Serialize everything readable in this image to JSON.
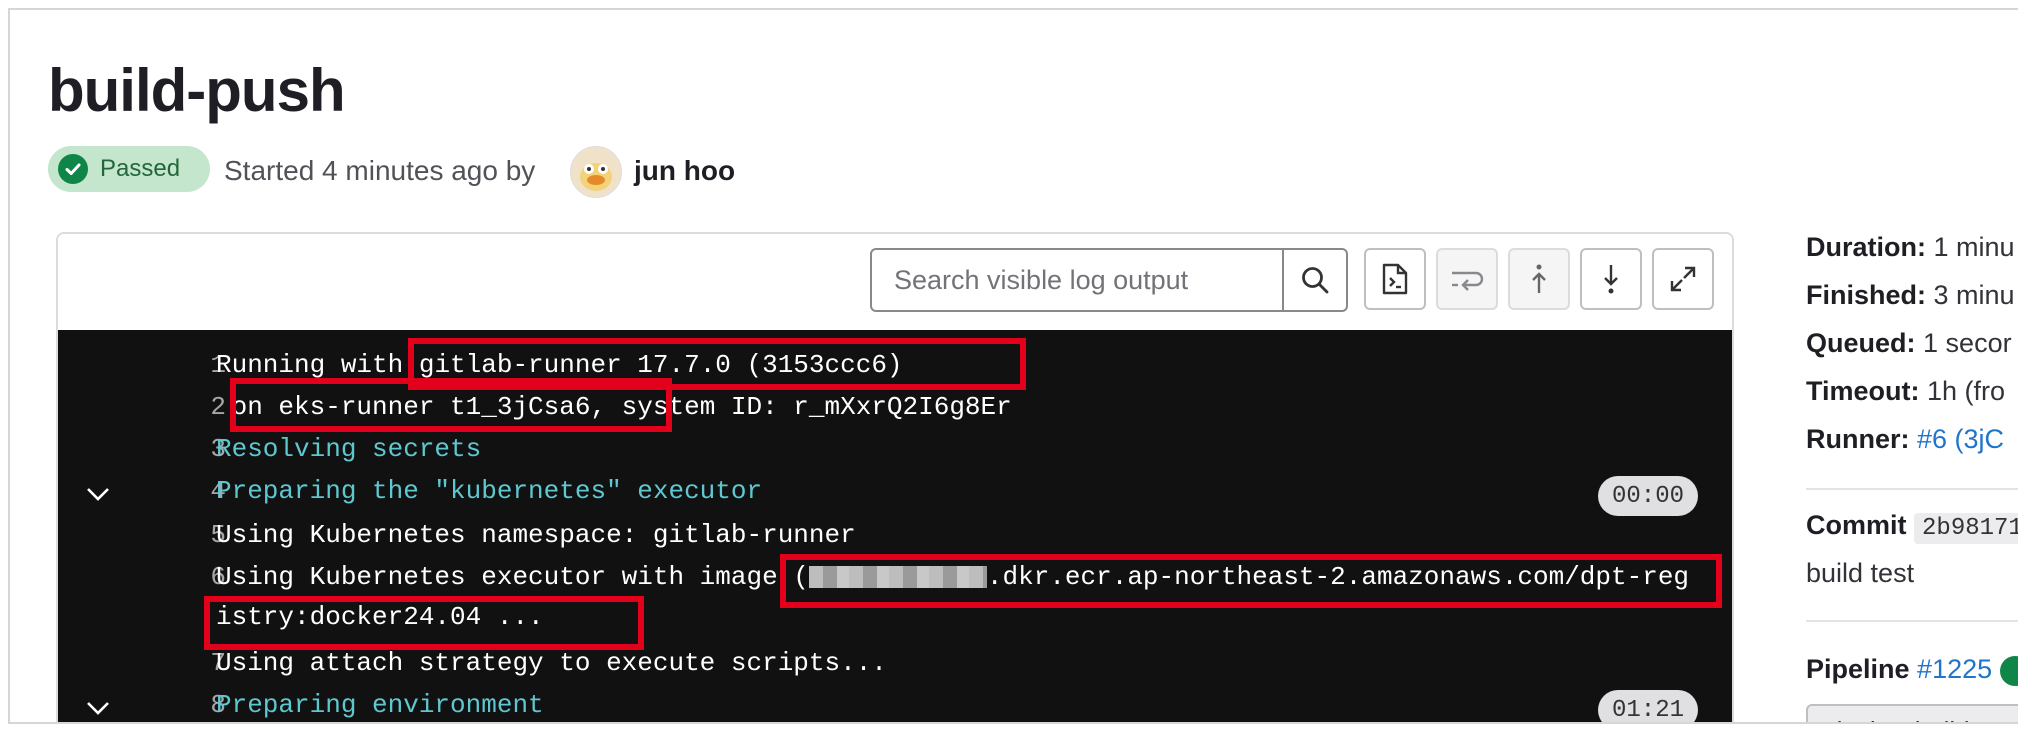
{
  "job": {
    "title": "build-push",
    "status": "Passed",
    "started_text": "Started 4 minutes ago by",
    "author": "jun hoo"
  },
  "toolbar": {
    "search_placeholder": "Search visible log output",
    "icons": [
      "search-icon",
      "raw-log-icon",
      "wrap-lines-icon",
      "scroll-top-icon",
      "scroll-bottom-icon",
      "fullscreen-icon"
    ]
  },
  "log": {
    "lines": [
      {
        "num": "1",
        "text_a": "Running with ",
        "text_b": "gitlab-runner 17.7.0 (3153ccc6)"
      },
      {
        "num": "2",
        "text_a": " on eks-runner t1_3jCsa6,",
        "text_b": " system ID: r_mXxrQ2I6g8Er"
      },
      {
        "num": "3",
        "text": "Resolving secrets"
      },
      {
        "num": "4",
        "text": "Preparing the \"kubernetes\" executor",
        "time": "00:00"
      },
      {
        "num": "5",
        "text": "Using Kubernetes namespace: gitlab-runner"
      },
      {
        "num": "6",
        "text_a": "Using Kubernetes executor with image (",
        "text_b": ".dkr.ecr.ap-northeast-2.amazonaws.com/dpt-reg",
        "text_c": "istry:docker24.04 ..."
      },
      {
        "num": "7",
        "text": "Using attach strategy to execute scripts..."
      },
      {
        "num": "8",
        "text": "Preparing environment",
        "time": "01:21"
      }
    ]
  },
  "sidebar": {
    "duration_label": "Duration:",
    "duration_value": "1 minu",
    "finished_label": "Finished:",
    "finished_value": "3 minu",
    "queued_label": "Queued:",
    "queued_value": "1 secor",
    "timeout_label": "Timeout:",
    "timeout_value": "1h (fro",
    "runner_label": "Runner:",
    "runner_value": "#6 (3jC",
    "commit_label": "Commit",
    "commit_sha": "2b98171",
    "commit_message": "build test",
    "pipeline_label": "Pipeline",
    "pipeline_id": "#1225",
    "stage_select": "docker-build"
  },
  "colors": {
    "passed_bg": "#c3e6cd",
    "passed_icon": "#108548",
    "log_bg": "#111111",
    "highlight_box": "#e3001b",
    "link": "#1f75cb"
  }
}
